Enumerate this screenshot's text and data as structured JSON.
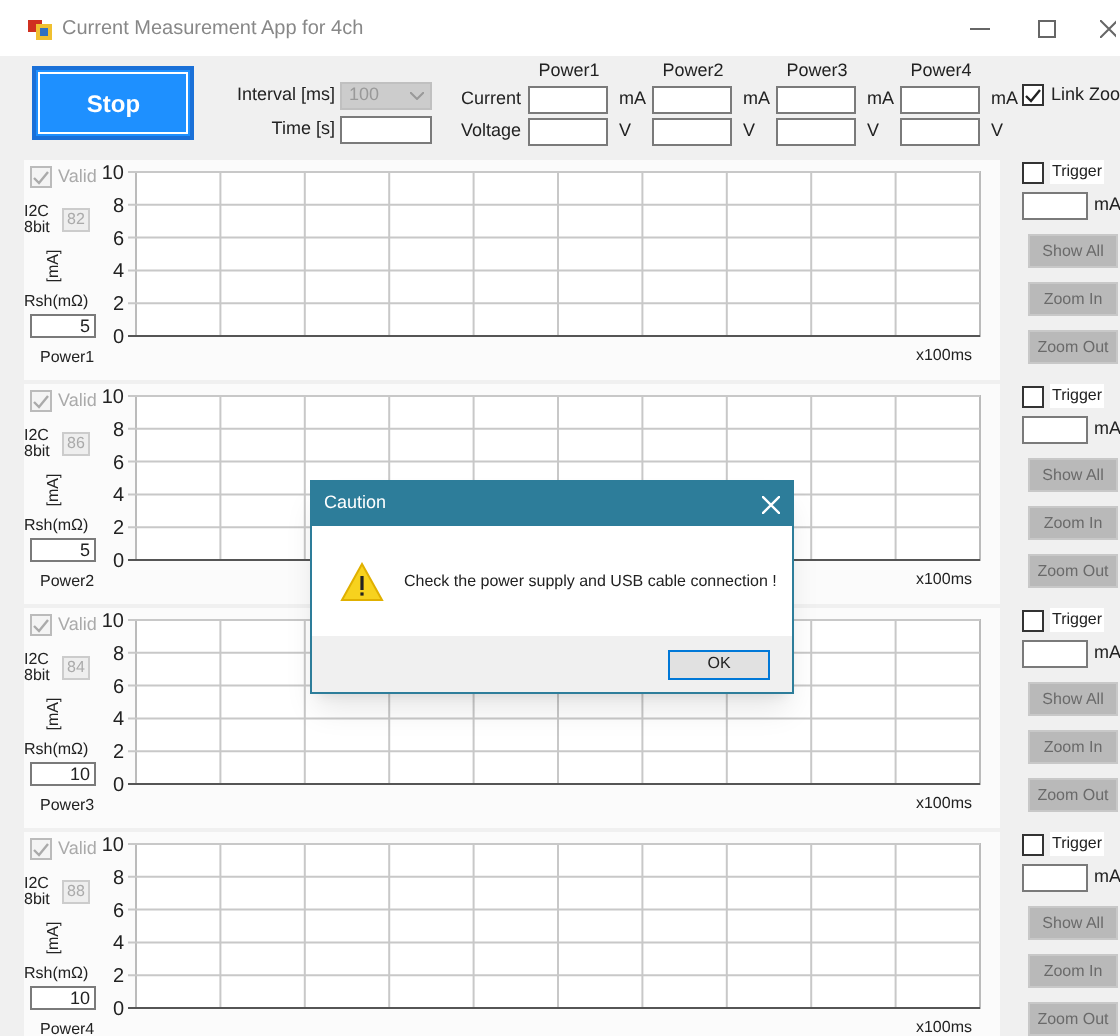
{
  "window": {
    "title": "Current Measurement App for 4ch"
  },
  "toolbar": {
    "stop_button": "Stop",
    "interval": {
      "label": "Interval [ms]",
      "value": "100",
      "disabled": true
    },
    "time": {
      "label": "Time [s]"
    }
  },
  "readings": {
    "current_label": "Current",
    "voltage_label": "Voltage",
    "columns": [
      {
        "name": "Power1",
        "current_unit": "mA",
        "voltage_unit": "V"
      },
      {
        "name": "Power2",
        "current_unit": "mA",
        "voltage_unit": "V"
      },
      {
        "name": "Power3",
        "current_unit": "mA",
        "voltage_unit": "V"
      },
      {
        "name": "Power4",
        "current_unit": "mA",
        "voltage_unit": "V"
      }
    ]
  },
  "link_zoom": {
    "label": "Link Zoo",
    "checked": true
  },
  "channels": [
    {
      "valid": {
        "label": "Valid",
        "checked": true,
        "disabled": true
      },
      "i2c_label": "I2C 8bit",
      "address": "82",
      "unit_label": "[mA]",
      "rsh_label": "Rsh(mΩ)",
      "rsh": "5",
      "name": "Power1",
      "y_ticks": [
        "10",
        "8",
        "6",
        "4",
        "2",
        "0"
      ],
      "x_unit": "x100ms",
      "trigger": {
        "label": "Trigger",
        "checked": false
      },
      "trigger_unit": "mA",
      "buttons": [
        {
          "label": "Show All",
          "disabled": true
        },
        {
          "label": "Zoom In",
          "disabled": true
        },
        {
          "label": "Zoom Out",
          "disabled": true
        }
      ]
    },
    {
      "valid": {
        "label": "Valid",
        "checked": true,
        "disabled": true
      },
      "i2c_label": "I2C 8bit",
      "address": "86",
      "unit_label": "[mA]",
      "rsh_label": "Rsh(mΩ)",
      "rsh": "5",
      "name": "Power2",
      "y_ticks": [
        "10",
        "8",
        "6",
        "4",
        "2",
        "0"
      ],
      "x_unit": "x100ms",
      "trigger": {
        "label": "Trigger",
        "checked": false
      },
      "trigger_unit": "mA",
      "buttons": [
        {
          "label": "Show All",
          "disabled": true
        },
        {
          "label": "Zoom In",
          "disabled": true
        },
        {
          "label": "Zoom Out",
          "disabled": true
        }
      ]
    },
    {
      "valid": {
        "label": "Valid",
        "checked": true,
        "disabled": true
      },
      "i2c_label": "I2C 8bit",
      "address": "84",
      "unit_label": "[mA]",
      "rsh_label": "Rsh(mΩ)",
      "rsh": "10",
      "name": "Power3",
      "y_ticks": [
        "10",
        "8",
        "6",
        "4",
        "2",
        "0"
      ],
      "x_unit": "x100ms",
      "trigger": {
        "label": "Trigger",
        "checked": false
      },
      "trigger_unit": "mA",
      "buttons": [
        {
          "label": "Show All",
          "disabled": true
        },
        {
          "label": "Zoom In",
          "disabled": true
        },
        {
          "label": "Zoom Out",
          "disabled": true
        }
      ]
    },
    {
      "valid": {
        "label": "Valid",
        "checked": true,
        "disabled": true
      },
      "i2c_label": "I2C 8bit",
      "address": "88",
      "unit_label": "[mA]",
      "rsh_label": "Rsh(mΩ)",
      "rsh": "10",
      "name": "Power4",
      "y_ticks": [
        "10",
        "8",
        "6",
        "4",
        "2",
        "0"
      ],
      "x_unit": "x100ms",
      "trigger": {
        "label": "Trigger",
        "checked": false
      },
      "trigger_unit": "mA",
      "buttons": [
        {
          "label": "Show All",
          "disabled": true
        },
        {
          "label": "Zoom In",
          "disabled": true
        },
        {
          "label": "Zoom Out",
          "disabled": true
        }
      ]
    }
  ],
  "dialog": {
    "title": "Caution",
    "message": "Check the power supply and USB cable connection !",
    "ok_button": "OK"
  }
}
